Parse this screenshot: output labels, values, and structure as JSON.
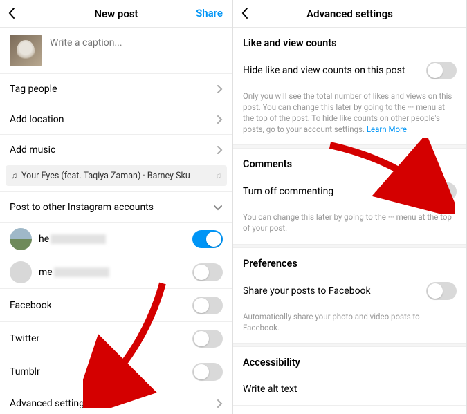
{
  "left": {
    "header": {
      "title": "New post",
      "action": "Share"
    },
    "caption_placeholder": "Write a caption...",
    "rows": {
      "tag": "Tag people",
      "location": "Add location",
      "music": "Add music",
      "music_chip": "Your Eyes (feat. Taqiya Zaman) · Barney Sku",
      "post_other": "Post to other Instagram accounts",
      "account1": "he",
      "account2": "me",
      "facebook": "Facebook",
      "twitter": "Twitter",
      "tumblr": "Tumblr",
      "advanced": "Advanced settings"
    }
  },
  "right": {
    "header": {
      "title": "Advanced settings"
    },
    "sections": {
      "likes_head": "Like and view counts",
      "hide_likes": "Hide like and view counts on this post",
      "likes_help": "Only you will see the total number of likes and views on this post. You can change this later by going to the ··· menu at the top of the post. To hide like counts on other people's posts, go to your account settings. ",
      "learn_more": "Learn More",
      "comments_head": "Comments",
      "turn_off": "Turn off commenting",
      "comments_help": "You can change this later by going to the ··· menu at the top of your post.",
      "prefs_head": "Preferences",
      "share_fb": "Share your posts to Facebook",
      "prefs_help": "Automatically share your photo and video posts to Facebook.",
      "a11y_head": "Accessibility",
      "alt_text": "Write alt text"
    }
  }
}
